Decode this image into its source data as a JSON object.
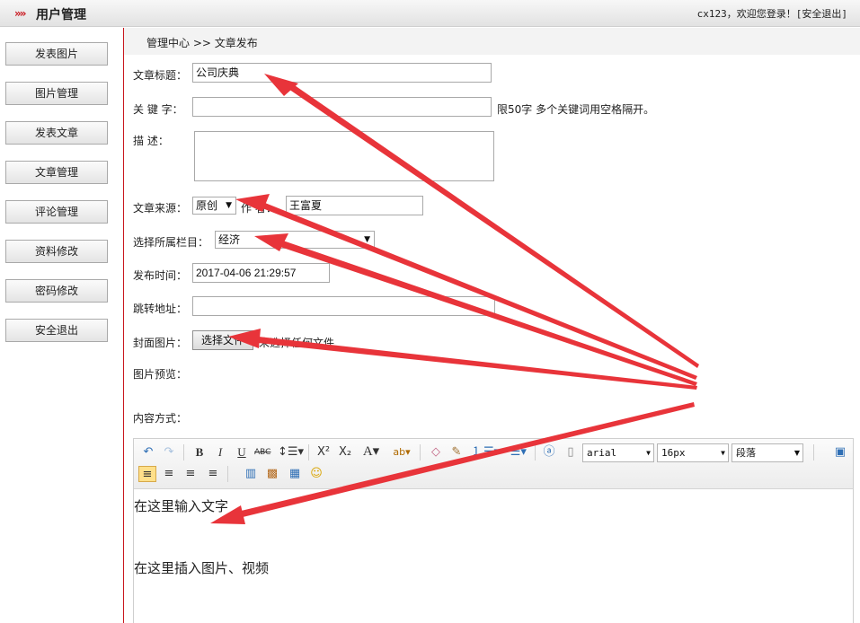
{
  "header": {
    "logo": "»»",
    "title": "用户管理",
    "user": "cx123",
    "welcome": "，欢迎您登录！",
    "logout": "[安全退出]"
  },
  "sidebar": {
    "items": [
      "发表图片",
      "图片管理",
      "发表文章",
      "文章管理",
      "评论管理",
      "资料修改",
      "密码修改",
      "安全退出"
    ]
  },
  "breadcrumb": "管理中心 >> 文章发布",
  "form": {
    "title_label": "文章标题：",
    "title_value": "公司庆典",
    "keywords_label": "关 键 字：",
    "keywords_value": "",
    "keywords_hint": "限50字 多个关键词用空格隔开。",
    "desc_label": "描    述：",
    "desc_value": "",
    "source_label": "文章来源：",
    "source_value": "原创",
    "author_label": "作 者：",
    "author_value": "王富夏",
    "column_label": "选择所属栏目：",
    "column_value": "经济",
    "time_label": "发布时间：",
    "time_value": "2017-04-06 21:29:57",
    "redirect_label": "跳转地址：",
    "redirect_value": "",
    "cover_label": "封面图片：",
    "file_button": "选择文件",
    "file_status": "未选择任何文件",
    "preview_label": "图片预览：",
    "content_mode_label": "内容方式："
  },
  "editor": {
    "font_family": "arial",
    "font_size": "16px",
    "paragraph": "段落",
    "lines": [
      "在这里输入文字",
      "在这里插入图片、视频"
    ]
  },
  "colors": {
    "accent": "#c8161d",
    "annotation": "#e8343a"
  }
}
